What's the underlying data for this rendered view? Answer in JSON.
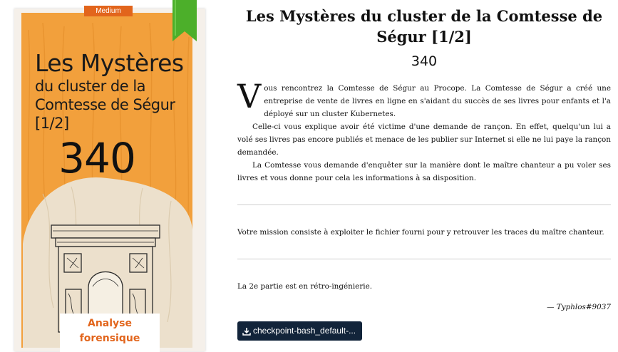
{
  "cover": {
    "badge": "Medium",
    "title_line1": "Les Mystères",
    "title_line2": "du cluster de la",
    "title_line3": "Comtesse de Ségur",
    "title_line4": "[1/2]",
    "points": "340",
    "category_line1": "Analyse",
    "category_line2": "forensique",
    "colors": {
      "orange": "#f2a03c",
      "badge": "#e2651c",
      "cream": "#ece0cc",
      "green": "#4caf2a"
    }
  },
  "challenge": {
    "title": "Les Mystères du cluster de la Comtesse de Ségur [1/2]",
    "points": "340",
    "dropcap": "V",
    "para1": "ous rencontrez la Comtesse de Ségur au Procope. La Comtesse de Ségur a créé une entreprise de vente de livres en ligne en s'aidant du succès de ses livres pour enfants et l'a déployé sur un cluster Kubernetes.",
    "para2": "Celle-ci vous explique avoir été victime d'une demande de rançon. En effet, quelqu'un lui a volé ses livres pas encore publiés et menace de les publier sur Internet si elle ne lui paye la rançon demandée.",
    "para3": "La Comtesse vous demande d'enquêter sur la manière dont le maître chanteur a pu voler ses livres et vous donne pour cela les informations à sa disposition.",
    "mission": "Votre mission consiste à exploiter le fichier fourni pour y retrouver les traces du maître chanteur.",
    "note": "La 2e partie est en rétro-ingénierie.",
    "author": "— Typhlos#9037",
    "download_label": "checkpoint-bash_default-..."
  }
}
